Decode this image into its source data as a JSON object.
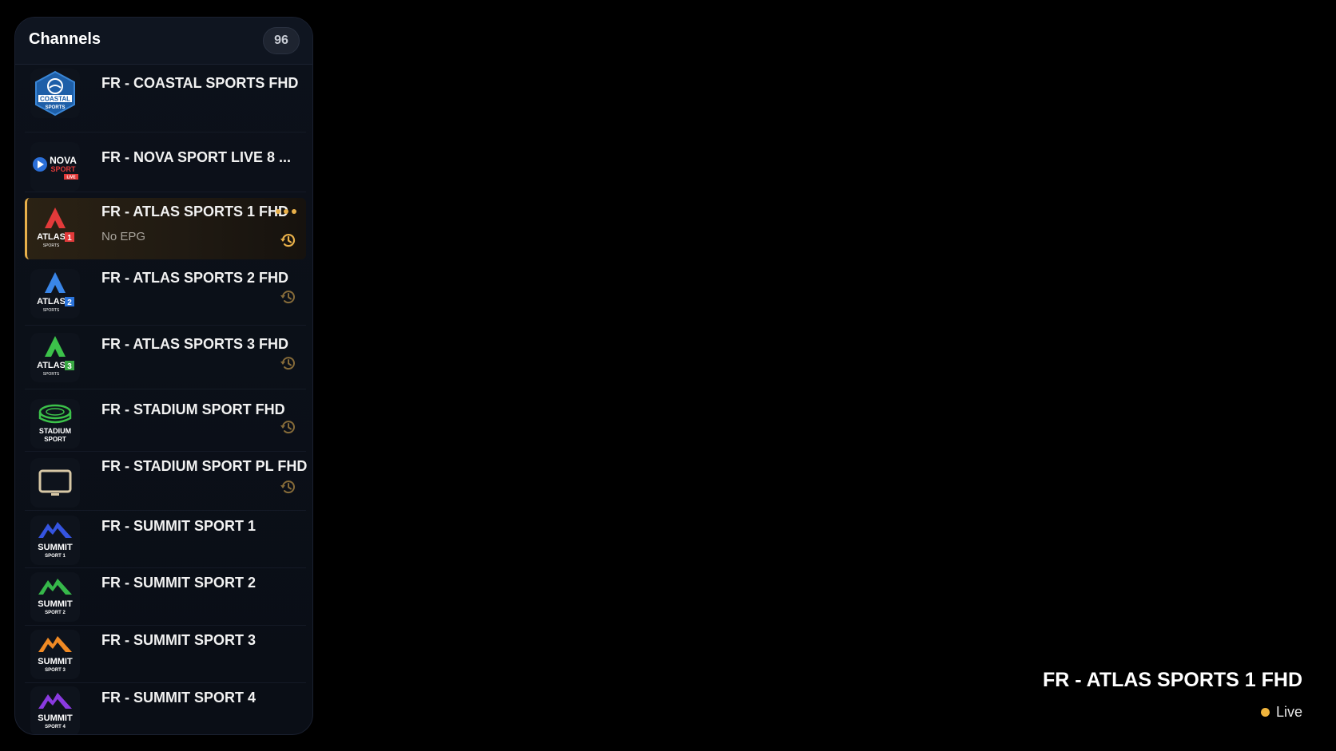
{
  "panel": {
    "title": "Channels",
    "count": "96"
  },
  "channels": [
    {
      "name": "FR - COASTAL SPORTS FHD",
      "logo": "coastal-sports-logo",
      "logo_text": "COASTAL",
      "logo_sub": "SPORTS"
    },
    {
      "name": "FR - NOVA SPORT LIVE 8 ...",
      "logo": "nova-sport-logo",
      "logo_text": "NOVA",
      "logo_sub": "SPORT",
      "logo_tag": "LIVE"
    },
    {
      "name": "FR - ATLAS SPORTS 1 FHD",
      "epg": "No EPG",
      "selected": true,
      "logo": "atlas-sports-1-logo",
      "logo_text": "ATLAS",
      "logo_num": "1",
      "logo_sub": "SPORTS"
    },
    {
      "name": "FR - ATLAS SPORTS 2 FHD",
      "logo": "atlas-sports-2-logo",
      "logo_text": "ATLAS",
      "logo_num": "2",
      "logo_sub": "SPORTS"
    },
    {
      "name": "FR - ATLAS SPORTS 3 FHD",
      "logo": "atlas-sports-3-logo",
      "logo_text": "ATLAS",
      "logo_num": "3",
      "logo_sub": "SPORTS"
    },
    {
      "name": "FR - STADIUM SPORT FHD",
      "logo": "stadium-sport-logo",
      "logo_text": "STADIUM",
      "logo_sub": "SPORT"
    },
    {
      "name": "FR - STADIUM SPORT PL FHD",
      "logo": "tv-icon"
    },
    {
      "name": "FR - SUMMIT SPORT 1",
      "logo": "summit-sport-1-logo",
      "logo_text": "SUMMIT",
      "logo_sub": "SPORT 1"
    },
    {
      "name": "FR - SUMMIT SPORT 2",
      "logo": "summit-sport-2-logo",
      "logo_text": "SUMMIT",
      "logo_sub": "SPORT 2"
    },
    {
      "name": "FR - SUMMIT SPORT 3",
      "logo": "summit-sport-3-logo",
      "logo_text": "SUMMIT",
      "logo_sub": "SPORT 3"
    },
    {
      "name": "FR - SUMMIT SPORT 4",
      "logo": "summit-sport-4-logo",
      "logo_text": "SUMMIT",
      "logo_sub": "SPORT 4"
    }
  ],
  "now_playing": {
    "title": "FR - ATLAS SPORTS 1 FHD",
    "status": "Live"
  },
  "colors": {
    "accent": "#e8b04a",
    "live_dot": "#f0b43c",
    "background": "#000000",
    "panel": "#0c111a"
  }
}
